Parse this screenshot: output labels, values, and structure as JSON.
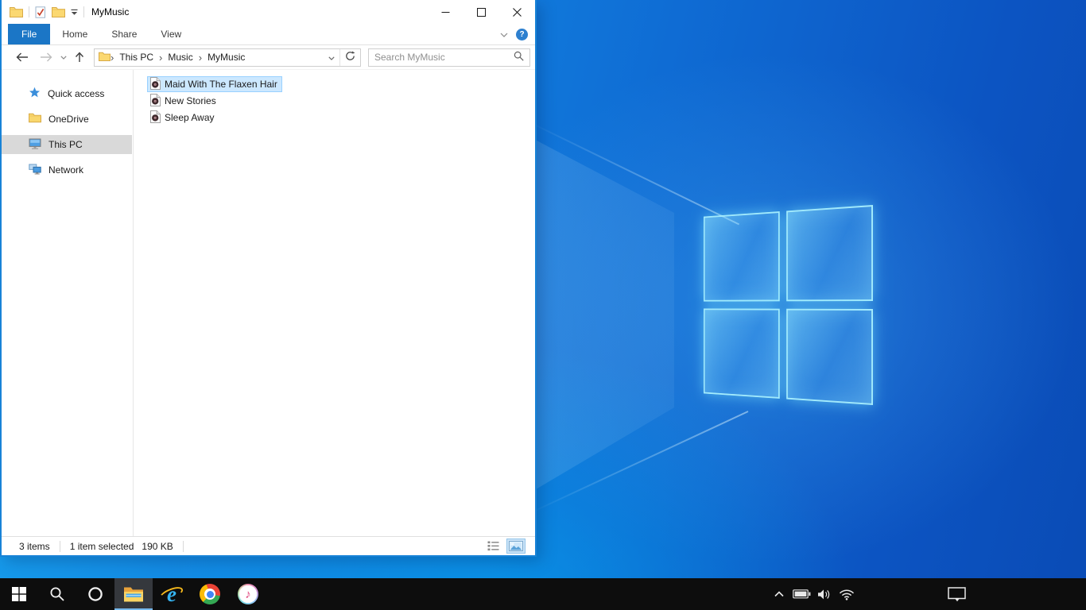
{
  "window": {
    "title": "MyMusic",
    "qat_icons": [
      "window-folder",
      "properties",
      "new-folder",
      "customize-quick-access"
    ],
    "controls": [
      "minimize",
      "maximize",
      "close"
    ]
  },
  "ribbon": {
    "tabs": [
      {
        "label": "File",
        "active": true
      },
      {
        "label": "Home",
        "active": false
      },
      {
        "label": "Share",
        "active": false
      },
      {
        "label": "View",
        "active": false
      }
    ],
    "help_glyph": "?"
  },
  "navbar": {
    "breadcrumb": [
      "This PC",
      "Music",
      "MyMusic"
    ],
    "crumb_separator": "›",
    "search_placeholder": "Search MyMusic"
  },
  "sidebar": {
    "items": [
      {
        "label": "Quick access",
        "icon": "star",
        "selected": false
      },
      {
        "label": "OneDrive",
        "icon": "folder",
        "selected": false
      },
      {
        "label": "This PC",
        "icon": "monitor",
        "selected": true
      },
      {
        "label": "Network",
        "icon": "network",
        "selected": false
      }
    ]
  },
  "files": {
    "items": [
      {
        "name": "Maid With The Flaxen Hair",
        "icon": "music-file",
        "selected": true
      },
      {
        "name": "New Stories",
        "icon": "music-file",
        "selected": false
      },
      {
        "name": "Sleep Away",
        "icon": "music-file",
        "selected": false
      }
    ]
  },
  "statusbar": {
    "count": "3 items",
    "selection": "1 item selected",
    "size": "190 KB",
    "view_toggles": [
      "details-view",
      "large-thumbnails-view"
    ]
  },
  "taskbar": {
    "buttons": [
      "start",
      "search",
      "cortana",
      "file-explorer",
      "internet-explorer",
      "chrome",
      "itunes"
    ],
    "active_button": "file-explorer",
    "tray": [
      "hidden-icons-chevron",
      "battery",
      "volume",
      "network",
      "action-center"
    ]
  },
  "colors": {
    "accent": "#0078d7",
    "file_tab": "#1b76c6",
    "selection_bg": "#cce8ff",
    "selection_border": "#99d1ff",
    "sidebar_selected_bg": "#d9d9d9",
    "taskbar_bg": "#0d0d0d",
    "taskbar_underline": "#76b9ed"
  }
}
